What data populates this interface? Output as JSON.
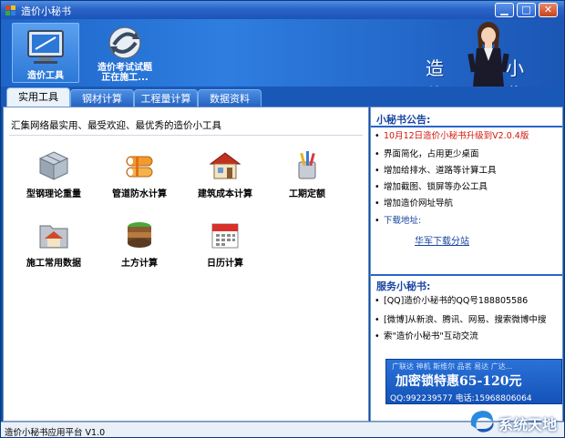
{
  "window": {
    "title": "造价小秘书"
  },
  "header": {
    "nav": [
      {
        "label": "造价工具"
      },
      {
        "label_line1": "造价考试试题",
        "label_line2": "正在施工..."
      }
    ],
    "brand_1": "造价",
    "brand_2": "小秘书"
  },
  "tabs": [
    "实用工具",
    "钢材计算",
    "工程量计算",
    "数据资料"
  ],
  "main": {
    "slogan": "汇集网络最实用、最受欢迎、最优秀的造价小工具",
    "tools": [
      {
        "label": "型钢理论重量",
        "icon": "steel-box-icon"
      },
      {
        "label": "管道防水计算",
        "icon": "pipe-icon"
      },
      {
        "label": "建筑成本计算",
        "icon": "house-icon"
      },
      {
        "label": "工期定额",
        "icon": "pencil-cup-icon"
      },
      {
        "label": "施工常用数据",
        "icon": "folder-icon"
      },
      {
        "label": "土方计算",
        "icon": "soil-layers-icon"
      },
      {
        "label": "日历计算",
        "icon": "calendar-icon"
      }
    ]
  },
  "sidebar": {
    "notice_title": "小秘书公告:",
    "notice_items": [
      {
        "text": "10月12日造价小秘书升级到V2.0.4版",
        "style": "red"
      },
      {
        "text": "界面简化，占用更少桌面",
        "style": "normal"
      },
      {
        "text": "增加给排水、道路等计算工具",
        "style": "normal"
      },
      {
        "text": "增加截图、锁屏等办公工具",
        "style": "normal"
      },
      {
        "text": "增加造价网址导航",
        "style": "normal"
      },
      {
        "text": "下载地址:",
        "style": "blue"
      }
    ],
    "download_link": "华军下载分站",
    "service_title": "服务小秘书:",
    "service_items": [
      "[QQ]造价小秘书的QQ号188805586",
      "[微博]从新浪、腾讯、网易、搜索微博中搜",
      "索\"造价小秘书\"互动交流"
    ],
    "ad": {
      "line1": "广联达 神机 斯维尔 品茗 易达 广达...",
      "line2": "加密锁特惠65-120元",
      "line3": "QQ:992239577  电话:15968806064"
    }
  },
  "status": {
    "text": "造价小秘书应用平台 V1.0"
  },
  "watermark": {
    "text": "系统天地"
  }
}
